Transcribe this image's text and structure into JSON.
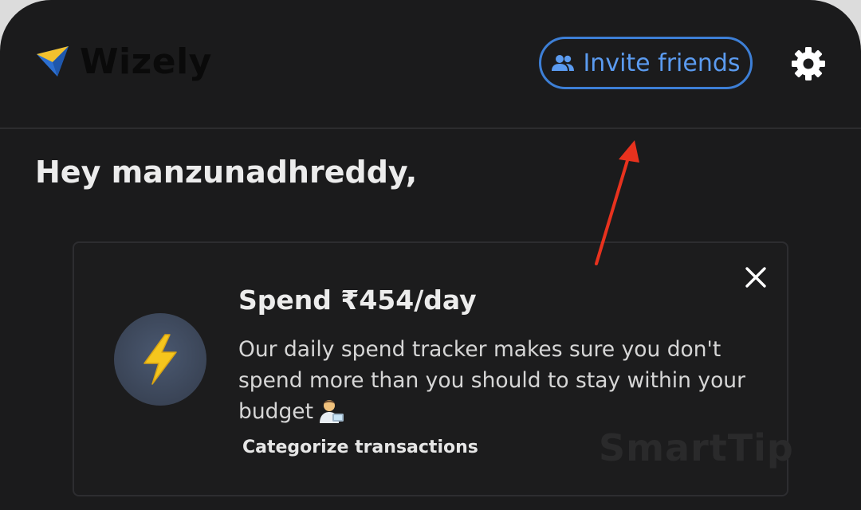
{
  "app": {
    "name": "Wizely"
  },
  "header": {
    "invite_label": "Invite friends",
    "invite_icon": "people-icon",
    "settings_icon": "gear-icon"
  },
  "greeting": "Hey manzunadhreddy,",
  "tip_card": {
    "title": "Spend ₹454/day",
    "body": "Our daily spend tracker makes sure you don't spend more than you should to stay within your budget",
    "emoji": "technologist-emoji",
    "link_label": "Categorize transactions",
    "watermark": "SmartTip",
    "close_icon": "close-icon",
    "bolt_icon": "lightning-bolt-icon"
  },
  "annotation": {
    "arrow_color": "#e8321e"
  },
  "colors": {
    "background": "#1b1b1c",
    "accent_blue": "#3d7fd6",
    "text_primary": "#ececec"
  }
}
